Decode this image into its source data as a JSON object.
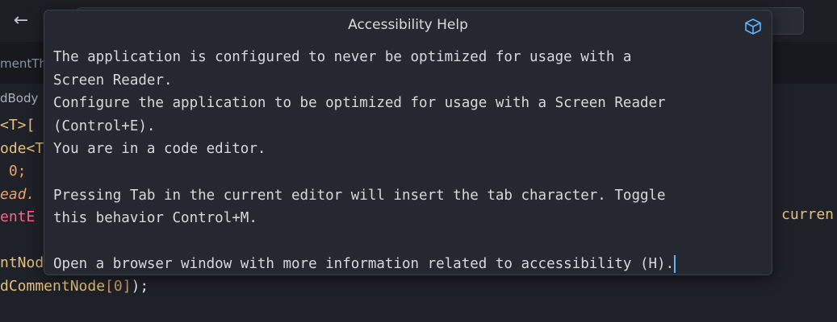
{
  "editor": {
    "tab_label": "mentTh",
    "breadcrumb": "dBody",
    "code_lines": [
      {
        "a": "<T>[",
        "b": "",
        "c": ""
      },
      {
        "a": "ode<T",
        "b": "",
        "c": ""
      },
      {
        "a": " 0;",
        "b": "",
        "c": ""
      },
      {
        "a": "ead.",
        "b": "",
        "c": ""
      },
      {
        "a": "entE",
        "b": "",
        "c": ""
      },
      {
        "a": "",
        "b": "",
        "c": ""
      },
      {
        "a": "ntNod",
        "b": "",
        "c": ""
      },
      {
        "a": "dCommentNode",
        "b": "[0]",
        "c": ");"
      }
    ],
    "right_identifier": "curren"
  },
  "accessibility_help": {
    "title": "Accessibility Help",
    "icon": "cube-icon",
    "lines": [
      "The application is configured to never be optimized for usage with a",
      "Screen Reader.",
      "Configure the application to be optimized for usage with a Screen Reader",
      "(Control+E).",
      "You are in a code editor.",
      "",
      "Pressing Tab in the current editor will insert the tab character. Toggle",
      "this behavior Control+M.",
      "",
      "Open a browser window with more information related to accessibility (H)."
    ]
  },
  "colors": {
    "background": "#1f2128",
    "dialog_bg": "#252830",
    "accent": "#5fb4ff"
  }
}
